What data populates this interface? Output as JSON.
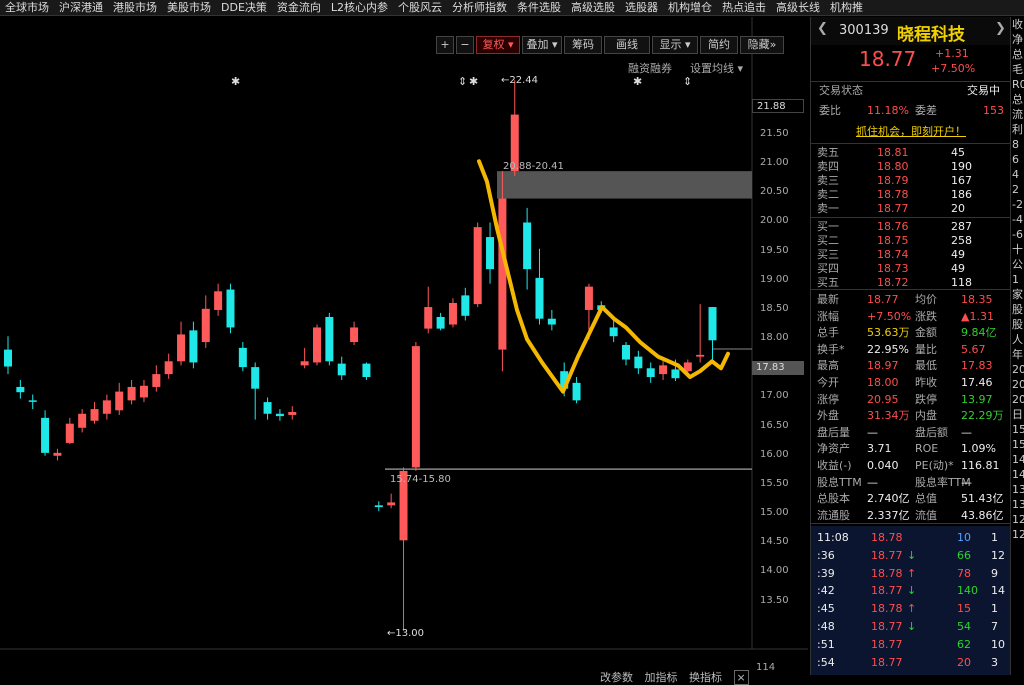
{
  "menu": [
    "全球市场",
    "沪深港通",
    "港股市场",
    "美股市场",
    "DDE决策",
    "资金流向",
    "L2核心内参",
    "个股风云",
    "分析师指数",
    "条件选股",
    "高级选股",
    "选股器",
    "机构增仓",
    "热点追击",
    "高级长线",
    "机构推"
  ],
  "toolbar": {
    "plus": "+",
    "minus": "−",
    "fuquan": "复权",
    "diejia": "叠加",
    "chouma": "筹码",
    "huaxian": "画线",
    "xianshi": "显示",
    "jianyue": "简约",
    "yincang": "隐藏"
  },
  "sub": {
    "rongzi": "融资融券",
    "junxian": "设置均线"
  },
  "chart": {
    "y_labels": [
      "21.50",
      "21.00",
      "20.50",
      "20.00",
      "19.50",
      "19.00",
      "18.50",
      "18.00",
      "17.50",
      "17.00",
      "16.50",
      "16.00",
      "15.50",
      "15.00",
      "14.50",
      "14.00",
      "13.50"
    ],
    "y_high": "21.88",
    "y_cur": "17.83",
    "y_vol": "114",
    "ann_high": "22.44",
    "ann_low": "13.00",
    "band_upper": "20.88-20.41",
    "band_lower": "15.74-15.80",
    "colors": {
      "up": "#ff5a5a",
      "down": "#1ee8e8",
      "line": "#f5b800"
    },
    "candles": [
      [
        17.82,
        17.53,
        18.05,
        17.4
      ],
      [
        17.18,
        17.09,
        17.3,
        16.98
      ],
      [
        16.95,
        16.93,
        17.05,
        16.8
      ],
      [
        16.65,
        16.05,
        16.78,
        16.0
      ],
      [
        16.0,
        16.05,
        16.12,
        15.92
      ],
      [
        16.22,
        16.55,
        16.65,
        16.2
      ],
      [
        16.48,
        16.72,
        16.8,
        16.4
      ],
      [
        16.6,
        16.8,
        16.92,
        16.55
      ],
      [
        16.72,
        16.95,
        17.05,
        16.62
      ],
      [
        16.78,
        17.1,
        17.25,
        16.7
      ],
      [
        16.95,
        17.18,
        17.3,
        16.88
      ],
      [
        17.0,
        17.2,
        17.3,
        16.92
      ],
      [
        17.18,
        17.4,
        17.55,
        17.1
      ],
      [
        17.4,
        17.62,
        17.75,
        17.32
      ],
      [
        17.62,
        18.08,
        18.3,
        17.55
      ],
      [
        18.15,
        17.6,
        18.3,
        17.5
      ],
      [
        17.95,
        18.52,
        18.75,
        17.85
      ],
      [
        18.5,
        18.82,
        18.95,
        18.4
      ],
      [
        18.85,
        18.2,
        18.95,
        18.1
      ],
      [
        17.85,
        17.52,
        17.95,
        17.45
      ],
      [
        17.52,
        17.15,
        17.6,
        16.62
      ],
      [
        16.92,
        16.72,
        17.0,
        16.62
      ],
      [
        16.72,
        16.68,
        16.8,
        16.6
      ],
      [
        16.7,
        16.75,
        16.85,
        16.62
      ],
      [
        17.55,
        17.62,
        17.85,
        17.5
      ],
      [
        17.6,
        18.2,
        18.25,
        17.55
      ],
      [
        18.38,
        17.62,
        18.45,
        17.55
      ],
      [
        17.58,
        17.38,
        17.7,
        17.3
      ],
      [
        17.95,
        18.2,
        18.3,
        17.9
      ],
      [
        17.58,
        17.35,
        17.6,
        17.3
      ],
      [
        15.15,
        15.12,
        15.22,
        15.05
      ],
      [
        15.15,
        15.2,
        15.35,
        15.1
      ],
      [
        14.55,
        15.74,
        15.8,
        13.0
      ],
      [
        15.8,
        17.88,
        17.95,
        15.74
      ],
      [
        18.18,
        18.55,
        18.9,
        18.1
      ],
      [
        18.38,
        18.18,
        18.45,
        18.15
      ],
      [
        18.25,
        18.62,
        18.7,
        18.2
      ],
      [
        18.75,
        18.4,
        18.88,
        18.32
      ],
      [
        18.6,
        19.92,
        20.0,
        18.55
      ],
      [
        19.75,
        19.2,
        20.0,
        18.95
      ],
      [
        17.82,
        20.41,
        20.88,
        17.45
      ],
      [
        20.88,
        21.85,
        22.44,
        20.8
      ],
      [
        20.0,
        19.2,
        20.25,
        18.85
      ],
      [
        19.05,
        18.35,
        19.55,
        18.25
      ],
      [
        18.35,
        18.25,
        18.5,
        18.15
      ],
      [
        17.45,
        17.15,
        17.6,
        17.02
      ],
      [
        17.25,
        16.95,
        17.35,
        16.9
      ],
      [
        18.5,
        18.9,
        18.95,
        18.0
      ],
      [
        18.58,
        18.5,
        18.65,
        18.45
      ],
      [
        18.2,
        18.05,
        18.35,
        17.95
      ],
      [
        17.9,
        17.65,
        17.95,
        17.55
      ],
      [
        17.7,
        17.5,
        17.8,
        17.4
      ],
      [
        17.5,
        17.35,
        17.6,
        17.25
      ],
      [
        17.4,
        17.55,
        17.62,
        17.3
      ],
      [
        17.48,
        17.33,
        17.65,
        17.28
      ],
      [
        17.45,
        17.6,
        17.65,
        17.35
      ],
      [
        17.7,
        17.73,
        18.6,
        17.6
      ],
      [
        18.55,
        17.98,
        18.55,
        17.6
      ]
    ],
    "polyline": [
      [
        21.05
      ],
      [
        20.7
      ],
      [
        19.9
      ],
      [
        19.2
      ],
      [
        18.5
      ],
      [
        18.0
      ],
      [
        17.6
      ],
      [
        17.1
      ],
      [
        17.7
      ],
      [
        18.55
      ],
      [
        18.35
      ],
      [
        18.2
      ],
      [
        17.95
      ],
      [
        17.7
      ],
      [
        17.55
      ],
      [
        17.35
      ],
      [
        17.45
      ],
      [
        17.62
      ],
      [
        17.5
      ],
      [
        17.75
      ]
    ]
  },
  "bottom": {
    "gaicanshu": "改参数",
    "jiazhibiao": "加指标",
    "huanzhibiao": "换指标"
  },
  "stock": {
    "code": "300139",
    "name": "晓程科技",
    "price": "18.77",
    "chg": "+1.31",
    "pct": "+7.50%"
  },
  "status": {
    "label": "交易状态",
    "value": "交易中"
  },
  "weibi": {
    "l1": "委比",
    "v1": "11.18%",
    "l2": "委差",
    "v2": "153"
  },
  "ad": "抓住机会，即刻开户！",
  "sell": [
    {
      "l": "卖五",
      "p": "18.81",
      "v": "45"
    },
    {
      "l": "卖四",
      "p": "18.80",
      "v": "190"
    },
    {
      "l": "卖三",
      "p": "18.79",
      "v": "167"
    },
    {
      "l": "卖二",
      "p": "18.78",
      "v": "186"
    },
    {
      "l": "卖一",
      "p": "18.77",
      "v": "20"
    }
  ],
  "buy": [
    {
      "l": "买一",
      "p": "18.76",
      "v": "287"
    },
    {
      "l": "买二",
      "p": "18.75",
      "v": "258"
    },
    {
      "l": "买三",
      "p": "18.74",
      "v": "49"
    },
    {
      "l": "买四",
      "p": "18.73",
      "v": "49"
    },
    {
      "l": "买五",
      "p": "18.72",
      "v": "118"
    }
  ],
  "stats": [
    {
      "l1": "最新",
      "v1": "18.77",
      "c1": "red",
      "l2": "均价",
      "v2": "18.35",
      "c2": "red"
    },
    {
      "l1": "涨幅",
      "v1": "+7.50%",
      "c1": "red",
      "l2": "涨跌",
      "v2": "▲1.31",
      "c2": "red"
    },
    {
      "l1": "总手",
      "v1": "53.63万",
      "c1": "yellow",
      "l2": "金额",
      "v2": "9.84亿",
      "c2": "green"
    },
    {
      "l1": "换手*",
      "v1": "22.95%",
      "c1": "white",
      "l2": "量比",
      "v2": "5.67",
      "c2": "red"
    },
    {
      "l1": "最高",
      "v1": "18.97",
      "c1": "red",
      "l2": "最低",
      "v2": "17.83",
      "c2": "red"
    },
    {
      "l1": "今开",
      "v1": "18.00",
      "c1": "red",
      "l2": "昨收",
      "v2": "17.46",
      "c2": "white"
    },
    {
      "l1": "涨停",
      "v1": "20.95",
      "c1": "red",
      "l2": "跌停",
      "v2": "13.97",
      "c2": "green"
    },
    {
      "l1": "外盘",
      "v1": "31.34万",
      "c1": "red",
      "l2": "内盘",
      "v2": "22.29万",
      "c2": "green"
    },
    {
      "l1": "盘后量",
      "v1": "—",
      "c1": "white",
      "l2": "盘后额",
      "v2": "—",
      "c2": "white"
    },
    {
      "l1": "净资产",
      "v1": "3.71",
      "c1": "white",
      "l2": "ROE",
      "v2": "1.09%",
      "c2": "white"
    },
    {
      "l1": "收益(-)",
      "v1": "0.040",
      "c1": "white",
      "l2": "PE(动)*",
      "v2": "116.81",
      "c2": "white"
    },
    {
      "l1": "股息TTM",
      "v1": "—",
      "c1": "white",
      "l2": "股息率TTM",
      "v2": "—",
      "c2": "white"
    },
    {
      "l1": "总股本",
      "v1": "2.740亿",
      "c1": "white",
      "l2": "总值",
      "v2": "51.43亿",
      "c2": "white"
    },
    {
      "l1": "流通股",
      "v1": "2.337亿",
      "c1": "white",
      "l2": "流值",
      "v2": "43.86亿",
      "c2": "white"
    }
  ],
  "ticks": [
    {
      "t": "11:08",
      "p": "18.78",
      "a": "",
      "ac": "",
      "v": "10",
      "n": "1",
      "vc": "blue"
    },
    {
      "t": ":36",
      "p": "18.77",
      "a": "↓",
      "ac": "green",
      "v": "66",
      "n": "12",
      "vc": "green"
    },
    {
      "t": ":39",
      "p": "18.78",
      "a": "↑",
      "ac": "red",
      "v": "78",
      "n": "9",
      "vc": "red"
    },
    {
      "t": ":42",
      "p": "18.77",
      "a": "↓",
      "ac": "green",
      "v": "140",
      "n": "14",
      "vc": "green"
    },
    {
      "t": ":45",
      "p": "18.78",
      "a": "↑",
      "ac": "red",
      "v": "15",
      "n": "1",
      "vc": "red"
    },
    {
      "t": ":48",
      "p": "18.77",
      "a": "↓",
      "ac": "green",
      "v": "54",
      "n": "7",
      "vc": "green"
    },
    {
      "t": ":51",
      "p": "18.77",
      "a": "",
      "ac": "",
      "v": "62",
      "n": "10",
      "vc": "green"
    },
    {
      "t": ":54",
      "p": "18.77",
      "a": "",
      "ac": "",
      "v": "20",
      "n": "3",
      "vc": "red"
    }
  ],
  "stub": [
    "收",
    "净",
    "总",
    "毛",
    "R0",
    "总",
    "流",
    "",
    "利",
    "",
    "8",
    "6",
    "4",
    "2",
    "-2",
    "-4",
    "-6",
    "",
    "十",
    "公",
    "1家",
    "股",
    "股",
    "人",
    "年",
    "20",
    "20",
    "20",
    "日",
    "15",
    "15",
    "14",
    "14",
    "13",
    "13",
    "12",
    "12"
  ]
}
